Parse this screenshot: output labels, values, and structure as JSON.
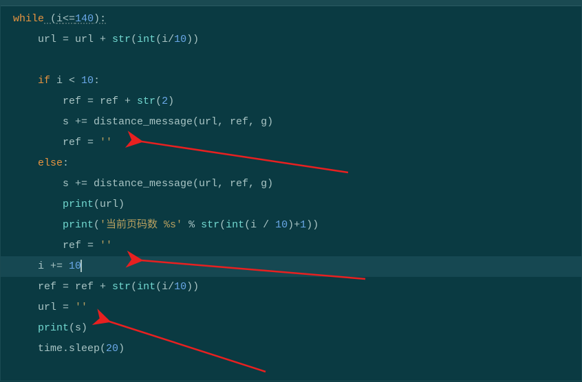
{
  "code": {
    "line1": {
      "kw_while": "while",
      "open_paren": " (",
      "var": "i",
      "op_leq": "<=",
      "num": "140",
      "close": "):"
    },
    "line2": {
      "indent": "    ",
      "assign": "url = url + ",
      "builtin1": "str",
      "p1": "(",
      "builtin2": "int",
      "p2": "(i/",
      "num": "10",
      "p3": "))"
    },
    "line3": "",
    "line4": {
      "indent": "    ",
      "kw_if": "if",
      "cond": " i < ",
      "num": "10",
      "colon": ":"
    },
    "line5": {
      "indent": "        ",
      "assign": "ref = ref + ",
      "builtin": "str",
      "p1": "(",
      "num": "2",
      "p2": ")"
    },
    "line6": {
      "indent": "        ",
      "assign": "s += distance_message(url, ref, g)"
    },
    "line7": {
      "indent": "        ",
      "assign": "ref = ",
      "str": "''"
    },
    "line8": {
      "indent": "    ",
      "kw_else": "else",
      "colon": ":"
    },
    "line9": {
      "indent": "        ",
      "assign": "s += distance_message(url, ref, g)"
    },
    "line10": {
      "indent": "        ",
      "builtin": "print",
      "p1": "(url)"
    },
    "line11": {
      "indent": "        ",
      "builtin": "print",
      "p1": "(",
      "str1": "'当前页码数 %s'",
      "op": " % ",
      "builtin2": "str",
      "p2": "(",
      "builtin3": "int",
      "p3": "(i / ",
      "num1": "10",
      "p4": ")+",
      "num2": "1",
      "p5": "))"
    },
    "line12": {
      "indent": "        ",
      "assign": "ref = ",
      "str": "''"
    },
    "line13": {
      "indent": "    ",
      "assign": "i += ",
      "num": "10"
    },
    "line14": {
      "indent": "    ",
      "assign": "ref = ref + ",
      "builtin1": "str",
      "p1": "(",
      "builtin2": "int",
      "p2": "(i/",
      "num": "10",
      "p3": "))"
    },
    "line15": {
      "indent": "    ",
      "assign": "url = ",
      "str": "''"
    },
    "line16": {
      "indent": "    ",
      "builtin": "print",
      "p1": "(s)"
    },
    "line17": {
      "indent": "    ",
      "assign": "time.sleep(",
      "num": "20",
      "p": ")"
    }
  },
  "colors": {
    "keyword": "#e89440",
    "builtin": "#72d8d0",
    "string": "#b8a060",
    "number": "#6aa8e8",
    "text": "#a8c4c4",
    "background": "#0a3a42",
    "arrow": "#e82020"
  }
}
